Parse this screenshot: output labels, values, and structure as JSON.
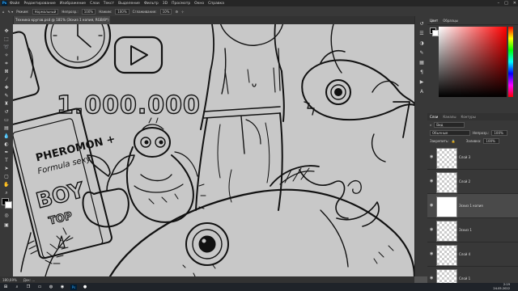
{
  "app": {
    "logo": "Ps",
    "menu": [
      "Файл",
      "Редактирование",
      "Изображение",
      "Слои",
      "Текст",
      "Выделение",
      "Фильтр",
      "3D",
      "Просмотр",
      "Окно",
      "Справка"
    ]
  },
  "options_bar": {
    "mode_label": "Режим:",
    "mode_value": "Нормальный",
    "opacity_label": "Непрозр.:",
    "opacity_value": "100%",
    "pressure_label": "Нажим:",
    "pressure_value": "100%",
    "smoothing_label": "Сглаживание:",
    "smoothing_value": "10%"
  },
  "document_tab": {
    "title": "Техника кругов.psd @ 181% (Эскиз 1 копия, RGB/8*) ×"
  },
  "status_bar": {
    "zoom": "180,69%",
    "doc_info": "Док: ..."
  },
  "right_panels": {
    "color_tabs": [
      "Цвет",
      "Образцы"
    ],
    "layers_tabs": [
      "Слои",
      "Каналы",
      "Контуры"
    ],
    "kind_label": "Вид",
    "blend_mode": "Обычные",
    "opacity_label": "Непрозр.:",
    "opacity_value": "100%",
    "lock_label": "Закрепить:",
    "fill_label": "Заливка:",
    "fill_value": "100%",
    "layers": [
      {
        "name": "Слой 3",
        "active": false
      },
      {
        "name": "Слой 2",
        "active": false
      },
      {
        "name": "Эскиз 1 копия",
        "active": true
      },
      {
        "name": "Эскиз 1",
        "active": false
      },
      {
        "name": "Слой 4",
        "active": false
      },
      {
        "name": "Слой 1",
        "active": false
      }
    ]
  },
  "canvas_text": {
    "views": "1.000.000",
    "card_line1": "PHEROMON +",
    "card_line2": "Formula sexy",
    "card_boy": "BOY",
    "card_top": "TOP"
  },
  "taskbar": {
    "time": "2:19",
    "date": "24.05.2022"
  },
  "colors": {
    "canvas_bg": "#c8c8c8",
    "panel_bg": "#383838",
    "menubar_bg": "#262626"
  }
}
